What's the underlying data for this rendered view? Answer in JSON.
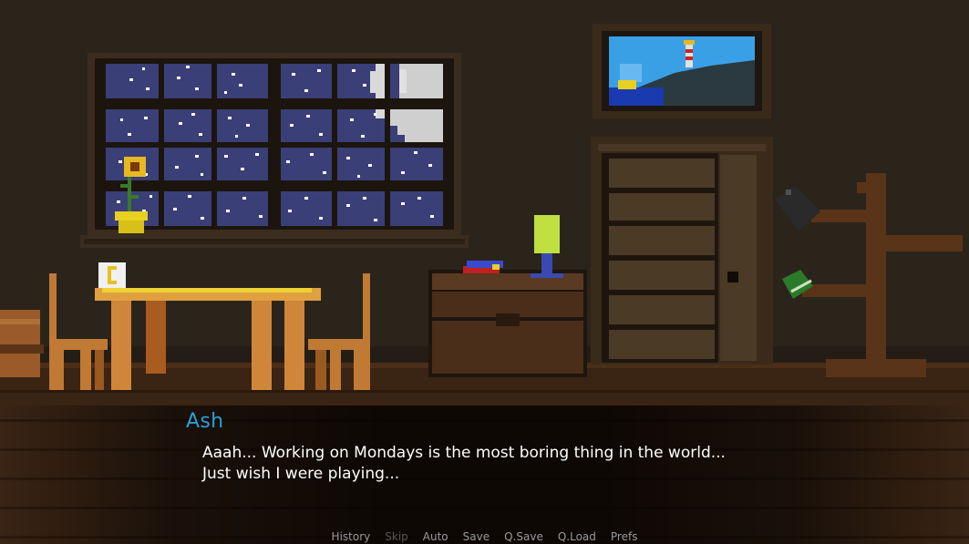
{
  "dialogue": {
    "speaker": "Ash",
    "text": "Aaah... Working on Mondays is the most boring thing in the world... Just wish I were playing..."
  },
  "quick_menu": [
    {
      "label": "History",
      "enabled": true
    },
    {
      "label": "Skip",
      "enabled": false
    },
    {
      "label": "Auto",
      "enabled": true
    },
    {
      "label": "Save",
      "enabled": true
    },
    {
      "label": "Q.Save",
      "enabled": true
    },
    {
      "label": "Q.Load",
      "enabled": true
    },
    {
      "label": "Prefs",
      "enabled": true
    }
  ],
  "colors": {
    "wall": "#2b241b",
    "floor": "#3a2414",
    "night_sky": "#3a3f78",
    "speaker_name": "#2a9fd6",
    "menu_text": "#9a9a9a"
  }
}
